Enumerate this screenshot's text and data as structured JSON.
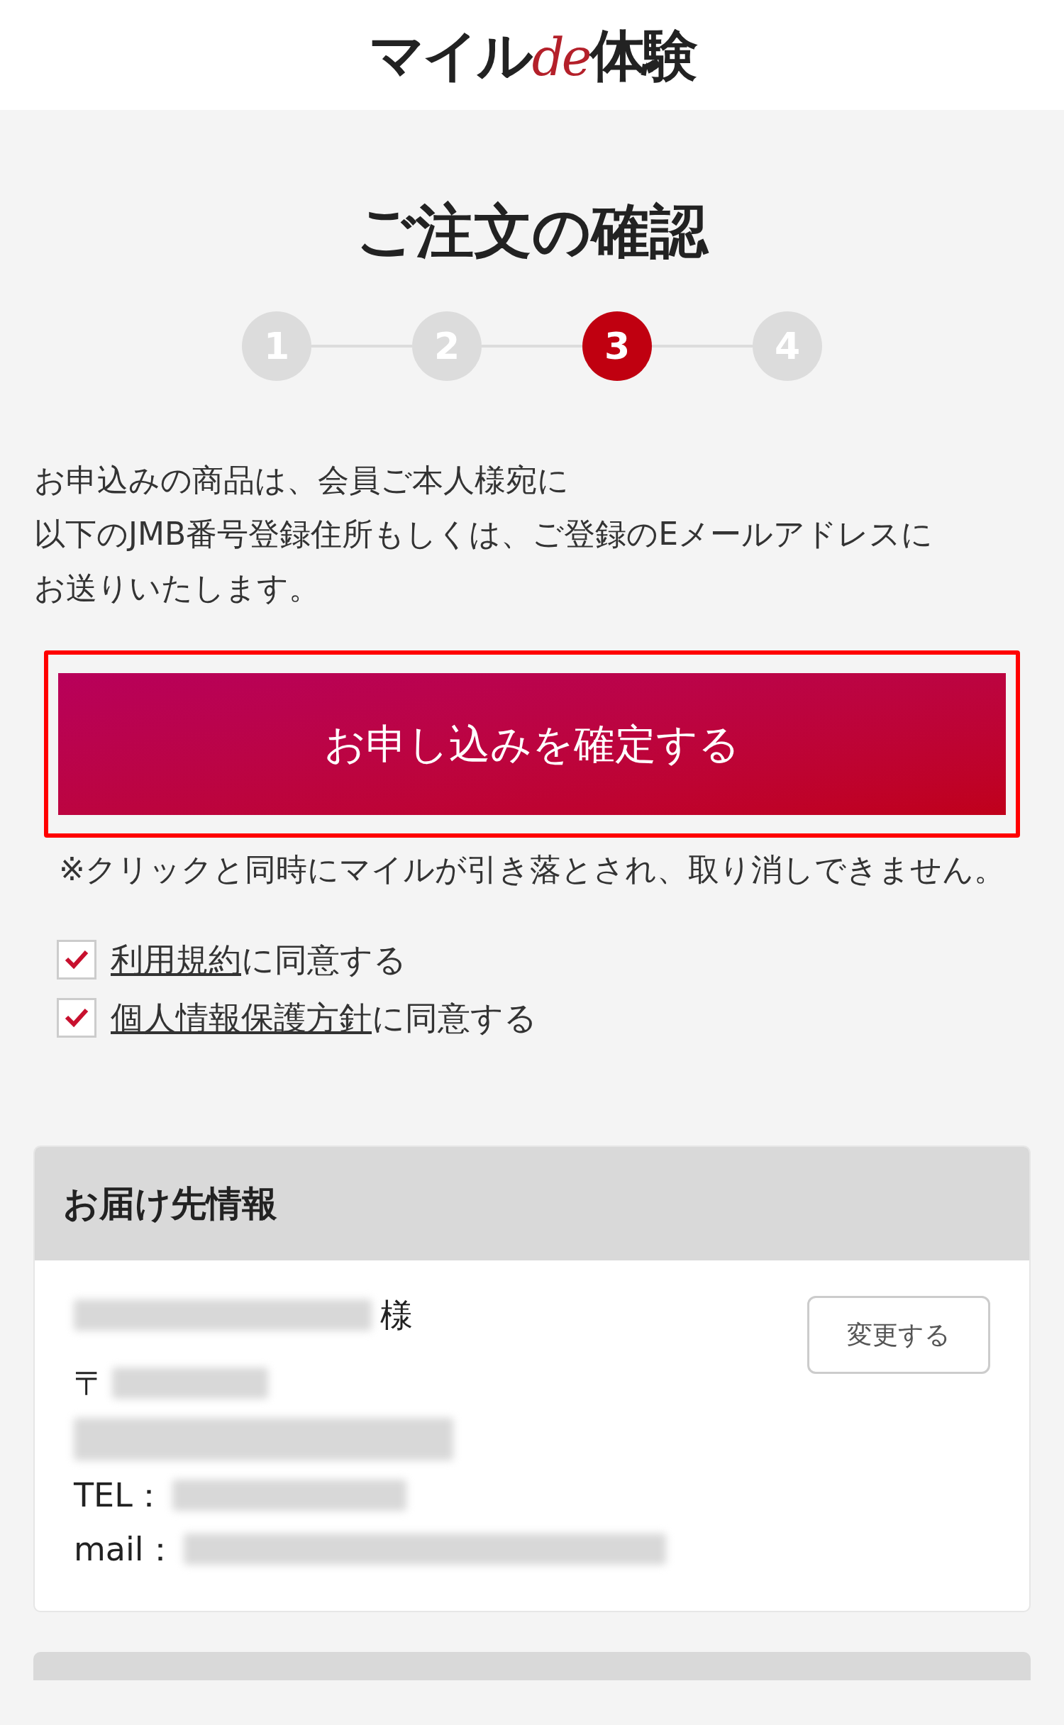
{
  "logo": {
    "before": "マイル",
    "accent": "de",
    "after": "体験"
  },
  "title": "ご注文の確認",
  "steps": [
    {
      "label": "1",
      "selected": false
    },
    {
      "label": "2",
      "selected": false
    },
    {
      "label": "3",
      "selected": true
    },
    {
      "label": "4",
      "selected": false
    }
  ],
  "notice": [
    "お申込みの商品は、会員ご本人様宛に",
    "以下のJMB番号登録住所もしくは、ご登録のEメールアドレスに",
    "お送りいたします。"
  ],
  "confirm_button": "お申し込みを確定する",
  "warning": "※クリックと同時にマイルが引き落とされ、取り消しできません。",
  "agreements": [
    {
      "link": "利用規約",
      "text": "に同意する",
      "checked": true
    },
    {
      "link": "個人情報保護方針",
      "text": "に同意する",
      "checked": true
    }
  ],
  "delivery": {
    "heading": "お届け先情報",
    "honorific": "様",
    "change_button": "変更する",
    "postal_mark": "〒",
    "tel_label": "TEL：",
    "mail_label": "mail："
  }
}
